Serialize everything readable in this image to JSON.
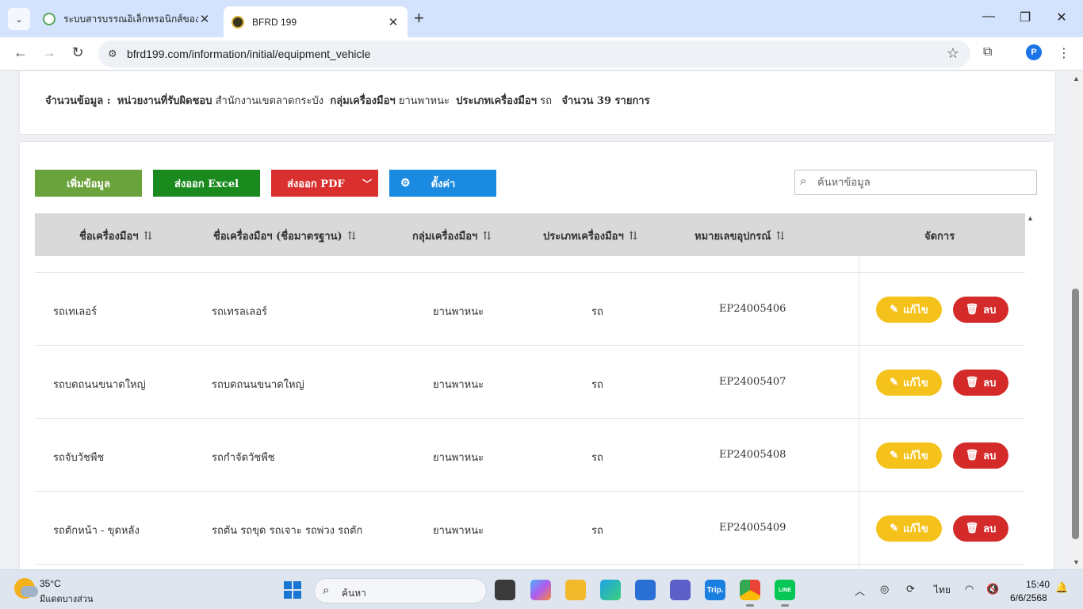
{
  "browser": {
    "tabs": [
      {
        "title": "ระบบสารบรรณอิเล็กทรอนิกส์ของกรุงเทพมหานคร"
      },
      {
        "title": "BFRD 199"
      }
    ],
    "url": "bfrd199.com/information/initial/equipment_vehicle",
    "profile_initial": "P"
  },
  "summary": {
    "count_label": "จำนวนข้อมูล :",
    "agency_label": "หน่วยงานที่รับผิดชอบ",
    "agency_value": "สำนักงานเขตลาดกระบัง",
    "group_label": "กลุ่มเครื่องมือฯ",
    "group_value": "ยานพาหนะ",
    "type_label": "ประเภทเครื่องมือฯ",
    "type_value": "รถ",
    "total_text": "จำนวน 39 รายการ"
  },
  "toolbar": {
    "add_label": "เพิ่มข้อมูล",
    "excel_label": "ส่งออก Excel",
    "pdf_label": "ส่งออก PDF",
    "settings_label": "ตั้งค่า",
    "search_placeholder": "ค้นหาข้อมูล"
  },
  "table": {
    "headers": [
      "ชื่อเครื่องมือฯ",
      "ชื่อเครื่องมือฯ (ชื่อมาตรฐาน)",
      "กลุ่มเครื่องมือฯ",
      "ประเภทเครื่องมือฯ",
      "หมายเลขอุปกรณ์",
      "จัดการ"
    ],
    "sort_glyph": "⇅",
    "edit_label": "แก้ไข",
    "delete_label": "ลบ",
    "rows": [
      [
        "รถเทเลอร์",
        "รถเทรลเลอร์",
        "ยานพาหนะ",
        "รถ",
        "EP24005406"
      ],
      [
        "รถบดถนนขนาดใหญ่",
        "รถบดถนนขนาดใหญ่",
        "ยานพาหนะ",
        "รถ",
        "EP24005407"
      ],
      [
        "รถจับวัชพืช",
        "รถกำจัดวัชพืช",
        "ยานพาหนะ",
        "รถ",
        "EP24005408"
      ],
      [
        "รถตักหน้า - ขุดหลัง",
        "รถตัน รถขุด รถเจาะ รถพ่วง รถตัก",
        "ยานพาหนะ",
        "รถ",
        "EP24005409"
      ]
    ]
  },
  "taskbar": {
    "temperature": "35°C",
    "condition": "มีแดดบางส่วน",
    "search_text": "ค้นหา",
    "language": "ไทย",
    "time": "15:40",
    "date": "6/6/2568",
    "trip_label": "Trip.",
    "line_label": "LINE"
  }
}
